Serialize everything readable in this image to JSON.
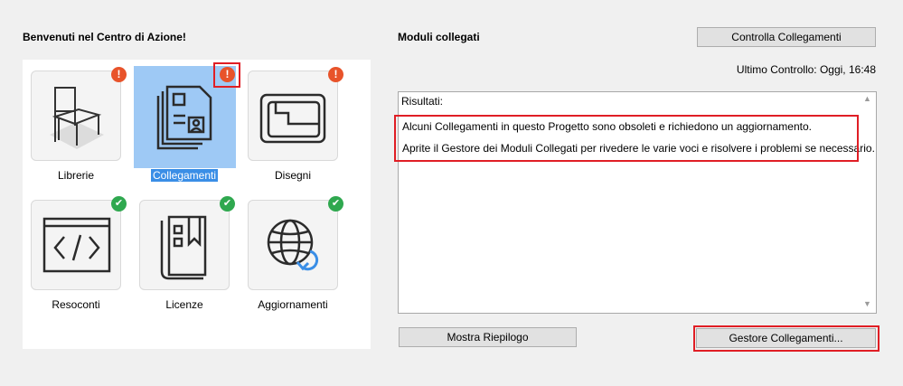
{
  "left_panel": {
    "title": "Benvenuti nel Centro di Azione!",
    "tiles": [
      {
        "label": "Librerie",
        "icon": "chair-icon",
        "status": "warning",
        "badge": "!"
      },
      {
        "label": "Collegamenti",
        "icon": "linked-files-icon",
        "status": "warning",
        "badge": "!",
        "selected": true
      },
      {
        "label": "Disegni",
        "icon": "drawing-sheet-icon",
        "status": "warning",
        "badge": "!"
      },
      {
        "label": "Resoconti",
        "icon": "code-report-icon",
        "status": "ok",
        "badge": "✔"
      },
      {
        "label": "Licenze",
        "icon": "license-icon",
        "status": "ok",
        "badge": "✔"
      },
      {
        "label": "Aggiornamenti",
        "icon": "globe-update-icon",
        "status": "ok",
        "badge": "✔"
      }
    ]
  },
  "right_panel": {
    "title": "Moduli collegati",
    "check_button": "Controlla Collegamenti",
    "last_check": "Ultimo Controllo: Oggi, 16:48",
    "results_label": "Risultati:",
    "messages": [
      "Alcuni Collegamenti in questo Progetto sono obsoleti e richiedono un aggiornamento.",
      "Aprite il Gestore dei Moduli Collegati per rivedere le varie voci e risolvere i problemi se necessario."
    ],
    "summary_button": "Mostra Riepilogo",
    "manager_button": "Gestore Collegamenti..."
  },
  "colors": {
    "warning": "#e8532a",
    "ok": "#2fa84f",
    "selection": "#9ec9f5",
    "highlight": "#e01e25"
  }
}
